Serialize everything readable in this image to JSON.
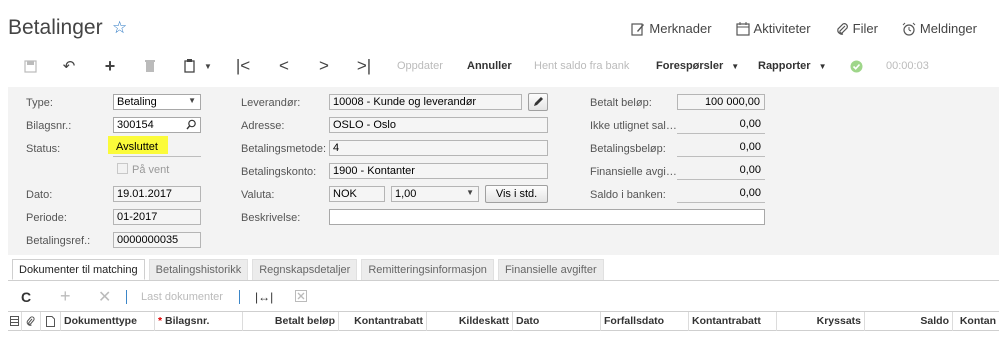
{
  "page": {
    "title": "Betalinger"
  },
  "top_actions": [
    {
      "label": "Merknader",
      "icon": "note-edit-icon"
    },
    {
      "label": "Aktiviteter",
      "icon": "calendar-icon"
    },
    {
      "label": "Filer",
      "icon": "paperclip-icon"
    },
    {
      "label": "Meldinger",
      "icon": "alarm-clock-icon"
    }
  ],
  "toolbar": {
    "oppdater": "Oppdater",
    "annuller": "Annuller",
    "hent_saldo": "Hent saldo fra bank",
    "foresporsler": "Forespørsler",
    "rapporter": "Rapporter",
    "timer": "00:00:03"
  },
  "form": {
    "type_label": "Type:",
    "type_value": "Betaling",
    "bilagsnr_label": "Bilagsnr.:",
    "bilagsnr_value": "300154",
    "status_label": "Status:",
    "status_value": "Avsluttet",
    "pa_vent_label": "På vent",
    "dato_label": "Dato:",
    "dato_value": "19.01.2017",
    "periode_label": "Periode:",
    "periode_value": "01-2017",
    "betalingsref_label": "Betalingsref.:",
    "betalingsref_value": "0000000035",
    "leverandor_label": "Leverandør:",
    "leverandor_value": "10008 - Kunde og leverandør",
    "adresse_label": "Adresse:",
    "adresse_value": "OSLO - Oslo",
    "betalingsmetode_label": "Betalingsmetode:",
    "betalingsmetode_value": "4",
    "betalingskonto_label": "Betalingskonto:",
    "betalingskonto_value": "1900 - Kontanter",
    "valuta_label": "Valuta:",
    "valuta_value": "NOK",
    "valuta_rate": "1,00",
    "vis_i_std": "Vis i std.",
    "beskrivelse_label": "Beskrivelse:",
    "beskrivelse_value": "",
    "betalt_belop_label": "Betalt beløp:",
    "betalt_belop_value": "100 000,00",
    "ikke_utlignet_label": "Ikke utlignet sal…",
    "ikke_utlignet_value": "0,00",
    "betalingsbelop_label": "Betalingsbeløp:",
    "betalingsbelop_value": "0,00",
    "finansielle_label": "Finansielle avgi…",
    "finansielle_value": "0,00",
    "saldo_banken_label": "Saldo i banken:",
    "saldo_banken_value": "0,00"
  },
  "tabs": [
    "Dokumenter til matching",
    "Betalingshistorikk",
    "Regnskapsdetaljer",
    "Remitteringsinformasjon",
    "Finansielle avgifter"
  ],
  "grid_toolbar": {
    "last_dokumenter": "Last dokumenter"
  },
  "grid_columns": [
    "Dokumenttype",
    "Bilagsnr.",
    "Betalt beløp",
    "Kontantrabatt",
    "Kildeskatt",
    "Dato",
    "Forfallsdato",
    "Kontantrabatt",
    "Kryssats",
    "Saldo",
    "Kontan"
  ],
  "colors": {
    "accent": "#2b78c4",
    "highlight": "#fbfb3a",
    "check_green": "#6cbf3c"
  }
}
